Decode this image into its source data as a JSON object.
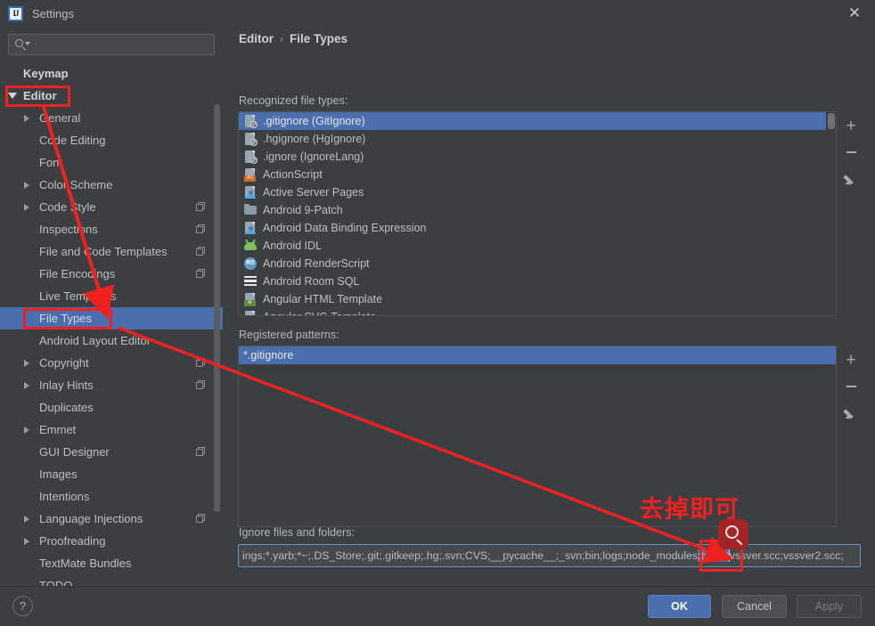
{
  "window": {
    "title": "Settings",
    "logo_text": "IJ",
    "close_label": "✕"
  },
  "search": {
    "value": "",
    "placeholder": ""
  },
  "sidebar": {
    "items": [
      {
        "label": "Keymap",
        "indent": 26,
        "arrow": "none",
        "bold": true,
        "selected": false,
        "copy": false
      },
      {
        "label": "Editor",
        "indent": 26,
        "arrow": "down",
        "bold": true,
        "selected": false,
        "copy": false
      },
      {
        "label": "General",
        "indent": 44,
        "arrow": "right",
        "bold": false,
        "selected": false,
        "copy": false
      },
      {
        "label": "Code Editing",
        "indent": 44,
        "arrow": "none",
        "bold": false,
        "selected": false,
        "copy": false
      },
      {
        "label": "Font",
        "indent": 44,
        "arrow": "none",
        "bold": false,
        "selected": false,
        "copy": false
      },
      {
        "label": "Color Scheme",
        "indent": 44,
        "arrow": "right",
        "bold": false,
        "selected": false,
        "copy": false
      },
      {
        "label": "Code Style",
        "indent": 44,
        "arrow": "right",
        "bold": false,
        "selected": false,
        "copy": true
      },
      {
        "label": "Inspections",
        "indent": 44,
        "arrow": "none",
        "bold": false,
        "selected": false,
        "copy": true
      },
      {
        "label": "File and Code Templates",
        "indent": 44,
        "arrow": "none",
        "bold": false,
        "selected": false,
        "copy": true
      },
      {
        "label": "File Encodings",
        "indent": 44,
        "arrow": "none",
        "bold": false,
        "selected": false,
        "copy": true
      },
      {
        "label": "Live Templates",
        "indent": 44,
        "arrow": "none",
        "bold": false,
        "selected": false,
        "copy": false
      },
      {
        "label": "File Types",
        "indent": 44,
        "arrow": "none",
        "bold": false,
        "selected": true,
        "copy": false
      },
      {
        "label": "Android Layout Editor",
        "indent": 44,
        "arrow": "none",
        "bold": false,
        "selected": false,
        "copy": false
      },
      {
        "label": "Copyright",
        "indent": 44,
        "arrow": "right",
        "bold": false,
        "selected": false,
        "copy": true
      },
      {
        "label": "Inlay Hints",
        "indent": 44,
        "arrow": "right",
        "bold": false,
        "selected": false,
        "copy": true
      },
      {
        "label": "Duplicates",
        "indent": 44,
        "arrow": "none",
        "bold": false,
        "selected": false,
        "copy": false
      },
      {
        "label": "Emmet",
        "indent": 44,
        "arrow": "right",
        "bold": false,
        "selected": false,
        "copy": false
      },
      {
        "label": "GUI Designer",
        "indent": 44,
        "arrow": "none",
        "bold": false,
        "selected": false,
        "copy": true
      },
      {
        "label": "Images",
        "indent": 44,
        "arrow": "none",
        "bold": false,
        "selected": false,
        "copy": false
      },
      {
        "label": "Intentions",
        "indent": 44,
        "arrow": "none",
        "bold": false,
        "selected": false,
        "copy": false
      },
      {
        "label": "Language Injections",
        "indent": 44,
        "arrow": "right",
        "bold": false,
        "selected": false,
        "copy": true
      },
      {
        "label": "Proofreading",
        "indent": 44,
        "arrow": "right",
        "bold": false,
        "selected": false,
        "copy": false
      },
      {
        "label": "TextMate Bundles",
        "indent": 44,
        "arrow": "none",
        "bold": false,
        "selected": false,
        "copy": false
      },
      {
        "label": "TODO",
        "indent": 44,
        "arrow": "none",
        "bold": false,
        "selected": false,
        "copy": false
      }
    ]
  },
  "breadcrumb": {
    "parent": "Editor",
    "separator": "›",
    "current": "File Types"
  },
  "main": {
    "recognized_label": "Recognized file types:",
    "registered_label": "Registered patterns:",
    "ignore_label": "Ignore files and folders:",
    "recognized_types": [
      {
        "label": ".gitignore (GitIgnore)",
        "icon": "file-ignore-icon",
        "selected": true
      },
      {
        "label": ".hgignore (HgIgnore)",
        "icon": "file-ignore-icon",
        "selected": false
      },
      {
        "label": ".ignore (IgnoreLang)",
        "icon": "file-ignore-icon",
        "selected": false
      },
      {
        "label": "ActionScript",
        "icon": "actionscript-icon",
        "selected": false
      },
      {
        "label": "Active Server Pages",
        "icon": "asp-icon",
        "selected": false
      },
      {
        "label": "Android 9-Patch",
        "icon": "folder-icon",
        "selected": false
      },
      {
        "label": "Android Data Binding Expression",
        "icon": "asp-icon",
        "selected": false
      },
      {
        "label": "Android IDL",
        "icon": "android-icon",
        "selected": false
      },
      {
        "label": "Android RenderScript",
        "icon": "renderscript-icon",
        "selected": false
      },
      {
        "label": "Android Room SQL",
        "icon": "sql-icon",
        "selected": false
      },
      {
        "label": "Angular HTML Template",
        "icon": "angular-html-icon",
        "selected": false
      },
      {
        "label": "Angular SVG Template",
        "icon": "angular-svg-icon",
        "selected": false
      }
    ],
    "registered_patterns": [
      {
        "label": "*.gitignore",
        "selected": true
      }
    ],
    "ignore_value_before": "ings;*.yarb;*~;.DS_Store;.git;.gitkeep;.hg;.svn;CVS;__pycache__;_svn;bin;logs;node_modules",
    "ignore_value_selected": ";target",
    "ignore_value_after": "vssver.scc;vssver2.scc;",
    "list_buttons": {
      "add": "+",
      "remove": "−",
      "edit": "pencil-icon"
    }
  },
  "footer": {
    "help": "?",
    "ok": "OK",
    "cancel": "Cancel",
    "apply": "Apply"
  },
  "annotation": {
    "note_text": "去掉即可",
    "color": "#ef2121"
  },
  "colors": {
    "background": "#3c3f41",
    "selection_blue": "#4b6eaf",
    "annotation_red": "#ef2121",
    "text": "#bbbbbb"
  }
}
